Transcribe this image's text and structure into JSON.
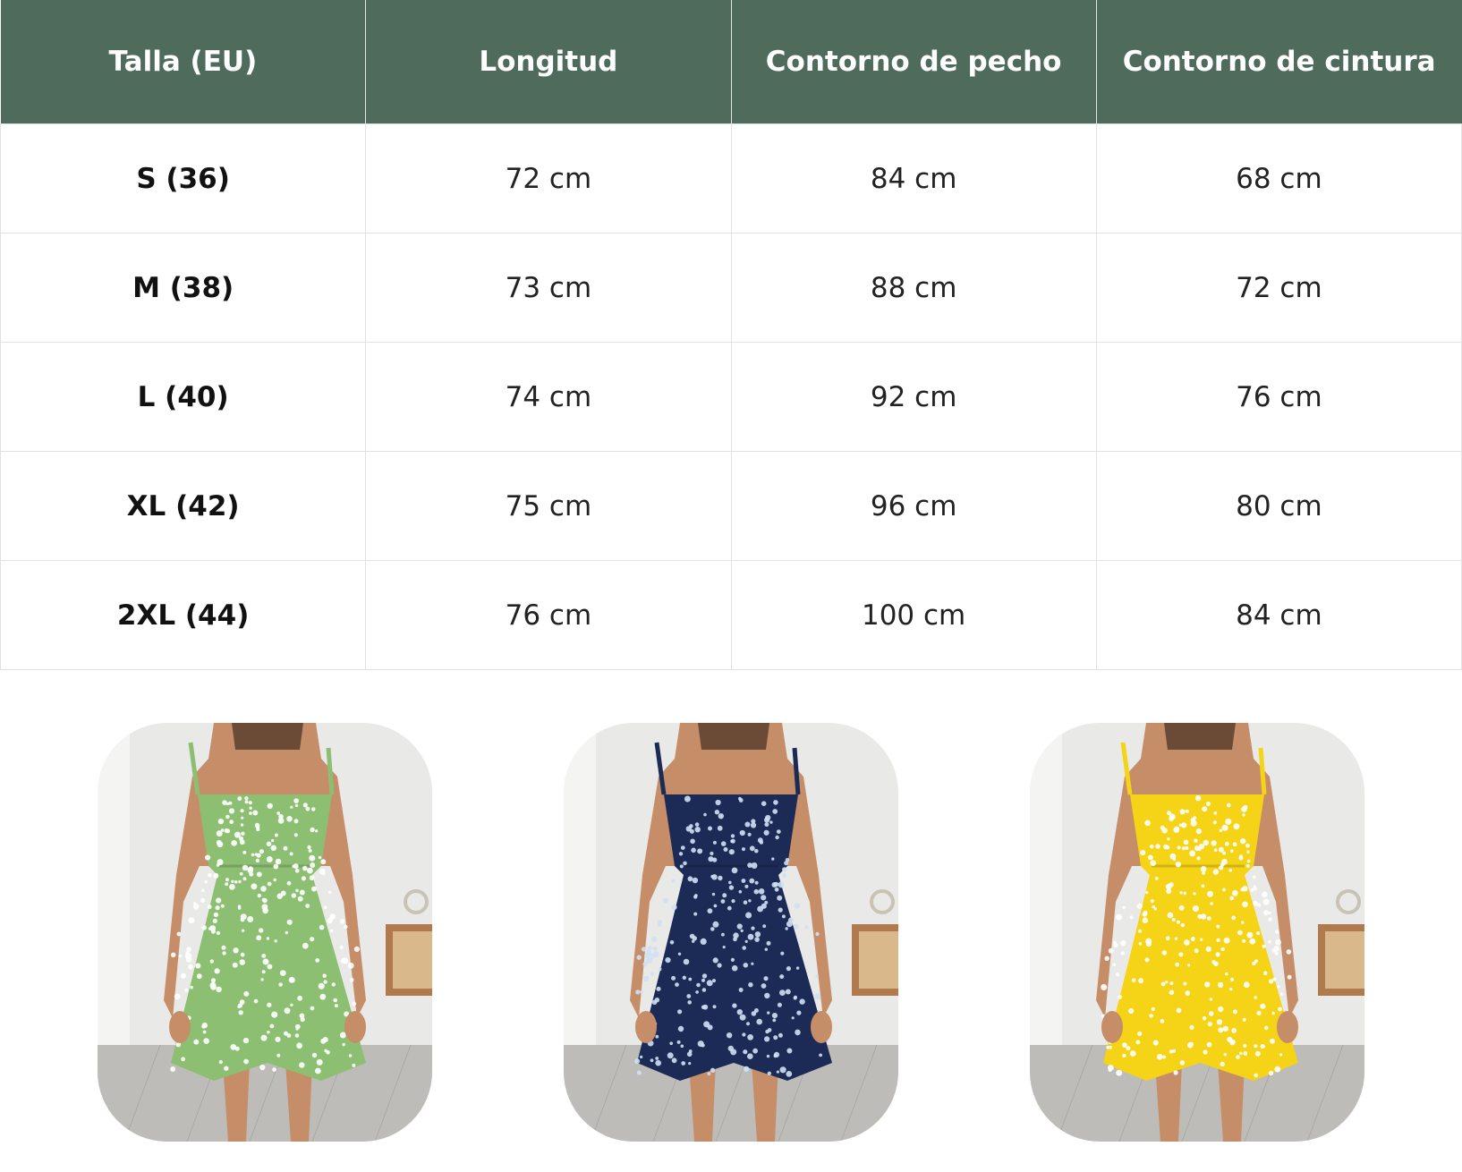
{
  "table": {
    "headers": [
      "Talla (EU)",
      "Longitud",
      "Contorno de pecho",
      "Contorno de cintura"
    ],
    "rows": [
      [
        "S (36)",
        "72 cm",
        "84 cm",
        "68 cm"
      ],
      [
        "M (38)",
        "73 cm",
        "88 cm",
        "72 cm"
      ],
      [
        "L (40)",
        "74 cm",
        "92 cm",
        "76 cm"
      ],
      [
        "XL (42)",
        "75 cm",
        "96 cm",
        "80 cm"
      ],
      [
        "2XL (44)",
        "76 cm",
        "100 cm",
        "84 cm"
      ]
    ]
  },
  "colors": {
    "header_bg": "#4e6b5c",
    "dress_green": "#8dbf73",
    "dress_navy": "#1c2b55",
    "dress_yellow": "#f5d316"
  },
  "photos": [
    {
      "dress_color": "#8dbf73",
      "icon": "dress-photo-green"
    },
    {
      "dress_color": "#1c2b55",
      "icon": "dress-photo-navy"
    },
    {
      "dress_color": "#f5d316",
      "icon": "dress-photo-yellow"
    }
  ]
}
